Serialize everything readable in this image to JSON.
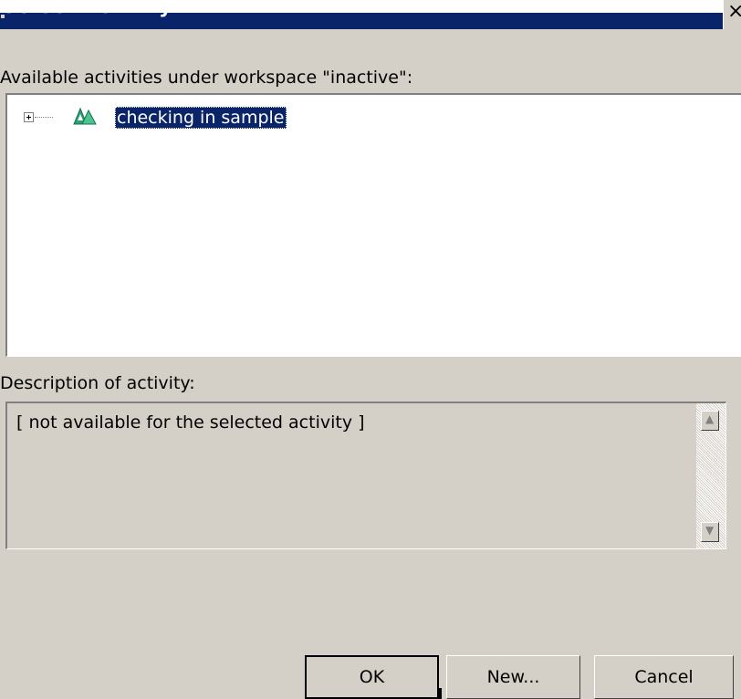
{
  "window": {
    "title": "Select Activity",
    "close_symbol": "×"
  },
  "tree": {
    "label": "Available activities under workspace \"inactive\":",
    "items": [
      {
        "label": "checking in sample",
        "icon": "activity-icon",
        "expander": "+",
        "selected": true
      }
    ]
  },
  "description": {
    "label": "Description of activity:",
    "text": "[ not available for the selected activity ]"
  },
  "buttons": {
    "ok": "OK",
    "new": "New...",
    "cancel": "Cancel"
  },
  "colors": {
    "dialog_bg": "#d4d0c8",
    "title_bar": "#0a246a",
    "selection": "#0a246a",
    "activity_icon": "#2e9e74"
  }
}
